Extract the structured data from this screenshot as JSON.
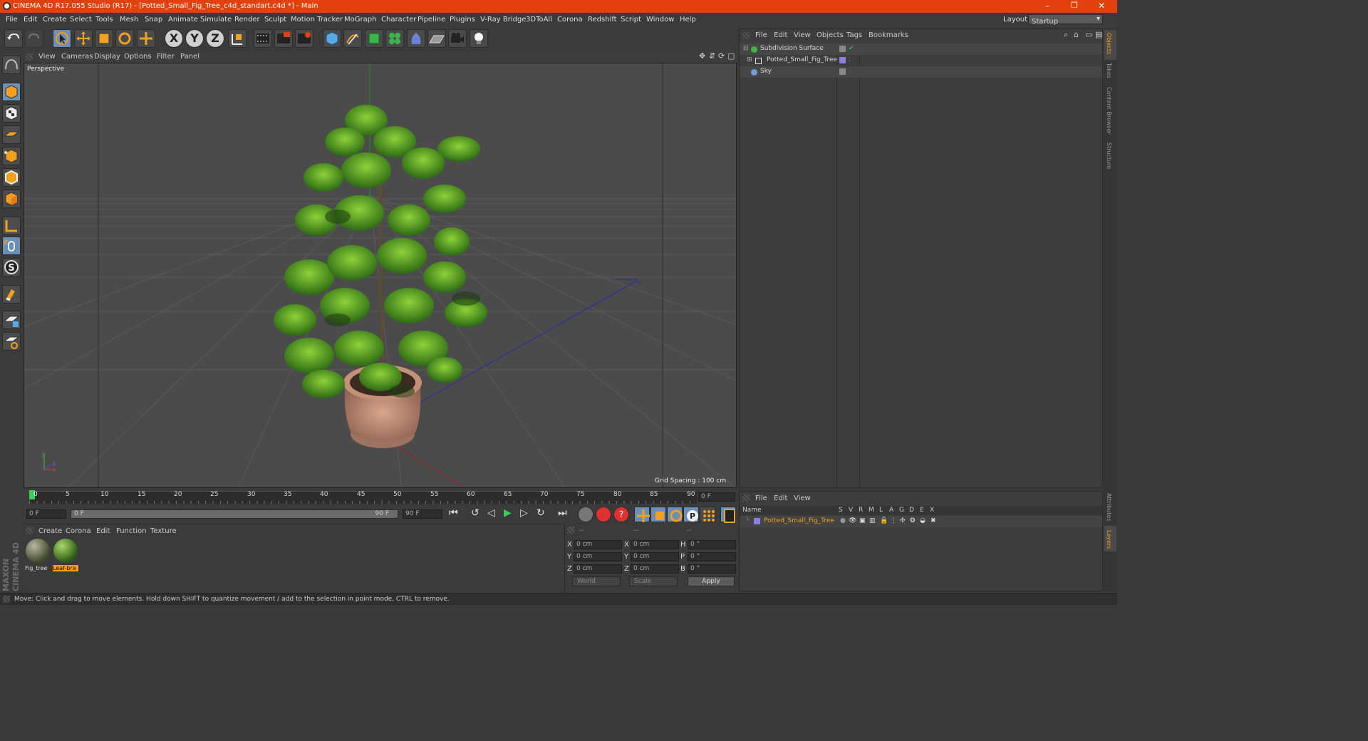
{
  "window": {
    "title": "CINEMA 4D R17.055 Studio (R17) - [Potted_Small_Fig_Tree_c4d_standart.c4d *] - Main",
    "minimize": "–",
    "restore": "❐",
    "close": "✕"
  },
  "menu": {
    "items": [
      "File",
      "Edit",
      "Create",
      "Select",
      "Tools",
      "Mesh",
      "Snap",
      "Animate",
      "Simulate",
      "Render",
      "Sculpt",
      "Motion Tracker",
      "MoGraph",
      "Character",
      "Pipeline",
      "Plugins",
      "V-Ray Bridge",
      "3DToAll",
      "Corona",
      "Redshift",
      "Script",
      "Window",
      "Help"
    ],
    "layout_label": "Layout:",
    "layout_value": "Startup"
  },
  "toolbar": {
    "axis_x": "X",
    "axis_y": "Y",
    "axis_z": "Z"
  },
  "viewport": {
    "menu": [
      "View",
      "Cameras",
      "Display",
      "Options",
      "Filter",
      "Panel"
    ],
    "label": "Perspective",
    "grid_spacing": "Grid Spacing : 100 cm",
    "axis_x": "x",
    "axis_y": "y",
    "axis_z": "z"
  },
  "timeline": {
    "ticks": [
      "0",
      "5",
      "10",
      "15",
      "20",
      "25",
      "30",
      "35",
      "40",
      "45",
      "50",
      "55",
      "60",
      "65",
      "70",
      "75",
      "80",
      "85",
      "90"
    ],
    "current_frame": "0 F",
    "start_frame": "0 F",
    "range_start": "0 F",
    "range_end": "90 F",
    "end_frame": "90 F"
  },
  "materials": {
    "menu": [
      "Create",
      "Corona",
      "Edit",
      "Function",
      "Texture"
    ],
    "items": [
      {
        "name": "Fig_tree",
        "selected": false
      },
      {
        "name": "Leaf-bra",
        "selected": true
      }
    ]
  },
  "coordinates": {
    "headers": [
      "--",
      "--",
      "--"
    ],
    "rows": [
      {
        "a": "X",
        "av": "0 cm",
        "b": "X",
        "bv": "0 cm",
        "c": "H",
        "cv": "0 °"
      },
      {
        "a": "Y",
        "av": "0 cm",
        "b": "Y",
        "bv": "0 cm",
        "c": "P",
        "cv": "0 °"
      },
      {
        "a": "Z",
        "av": "0 cm",
        "b": "Z",
        "bv": "0 cm",
        "c": "B",
        "cv": "0 °"
      }
    ],
    "world": "World",
    "scale": "Scale",
    "apply": "Apply"
  },
  "object_manager": {
    "menu": [
      "File",
      "Edit",
      "View",
      "Objects",
      "Tags",
      "Bookmarks"
    ],
    "objects": [
      {
        "name": "Subdivision Surface",
        "color": "#3fb34f"
      },
      {
        "name": "Potted_Small_Fig_Tree",
        "color": "#d0d0d0"
      },
      {
        "name": "Sky",
        "color": "#6f9fd8"
      }
    ]
  },
  "layer_manager": {
    "menu": [
      "File",
      "Edit",
      "View"
    ],
    "columns": [
      "Name",
      "S",
      "V",
      "R",
      "M",
      "L",
      "A",
      "G",
      "D",
      "E",
      "X"
    ],
    "layer": "Potted_Small_Fig_Tree",
    "layer_color": "#8b7fe0"
  },
  "right_tabs": [
    "Objects",
    "Takes",
    "Content Browser",
    "Structure",
    "Attributes",
    "Layers"
  ],
  "brand": "MAXON CINEMA 4D",
  "status": "Move: Click and drag to move elements. Hold down SHIFT to quantize movement / add to the selection in point mode, CTRL to remove.",
  "colors": {
    "accent": "#e2400c",
    "selected": "#6c8fb8",
    "highlight": "#f2a01e"
  }
}
